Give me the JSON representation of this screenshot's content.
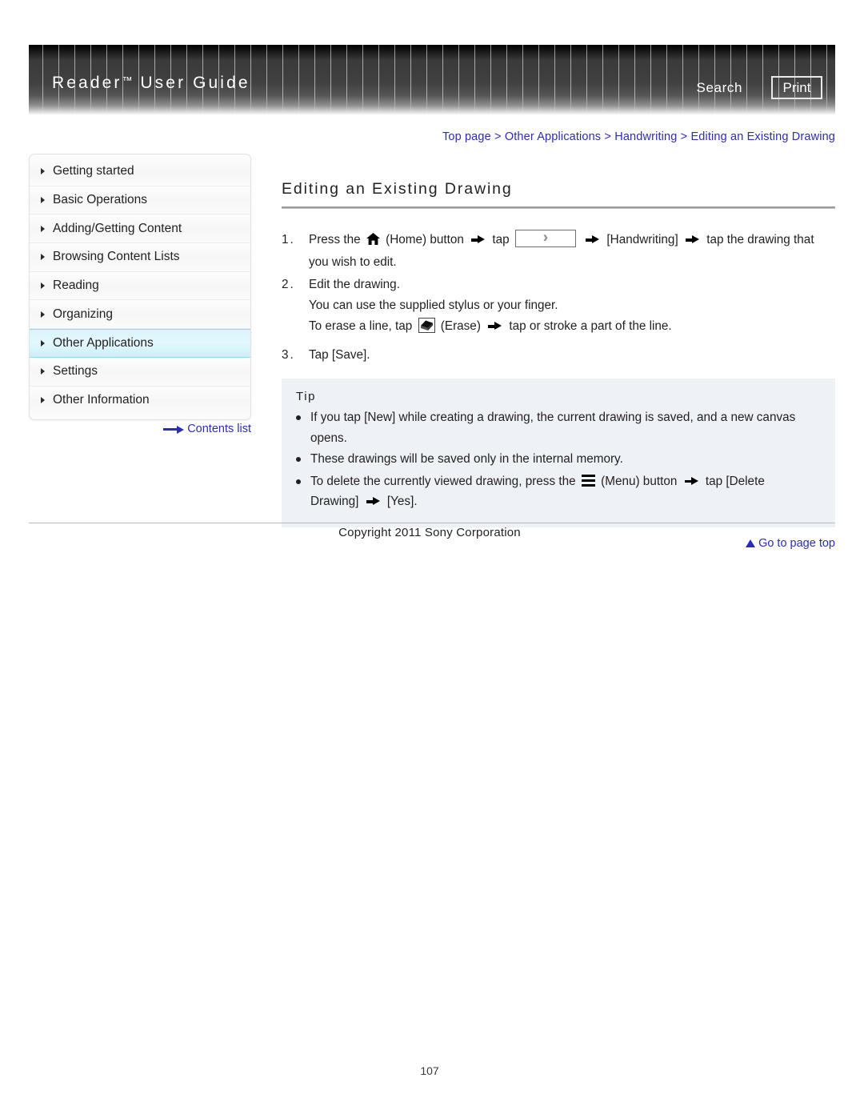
{
  "header": {
    "title": "Reader",
    "title_tm": "™",
    "title_rest": " User Guide",
    "search_label": "Search",
    "print_label": "Print"
  },
  "breadcrumb": {
    "items": [
      "Top page",
      "Other Applications",
      "Handwriting",
      "Editing an Existing Drawing"
    ],
    "separator": ">"
  },
  "sidebar": {
    "items": [
      {
        "label": "Getting started",
        "active": false
      },
      {
        "label": "Basic Operations",
        "active": false
      },
      {
        "label": "Adding/Getting Content",
        "active": false
      },
      {
        "label": "Browsing Content Lists",
        "active": false
      },
      {
        "label": "Reading",
        "active": false
      },
      {
        "label": "Organizing",
        "active": false
      },
      {
        "label": "Other Applications",
        "active": true
      },
      {
        "label": "Settings",
        "active": false
      },
      {
        "label": "Other Information",
        "active": false
      }
    ],
    "contents_list_label": "Contents list"
  },
  "main": {
    "page_title": "Editing an Existing Drawing",
    "steps": {
      "s1_num": "1.",
      "s1_a": "Press the",
      "s1_b": "(Home) button",
      "s1_c": "tap",
      "s1_d": "[Handwriting]",
      "s1_e": "tap the drawing that",
      "s1_f": "you wish to edit.",
      "s2_num": "2.",
      "s2_a": "Edit the drawing.",
      "s2_b": "You can use the supplied stylus or your finger.",
      "s2_c": "To erase a line, tap",
      "s2_d": "(Erase)",
      "s2_e": "tap or stroke a part of the line.",
      "s3_num": "3.",
      "s3_a": "Tap [Save]."
    },
    "tip": {
      "title": "Tip",
      "items": [
        "If you tap [New] while creating a drawing, the current drawing is saved, and a new canvas opens.",
        "These drawings will be saved only in the internal memory."
      ],
      "item3_a": "To delete the currently viewed drawing, press the",
      "item3_b": "(Menu) button",
      "item3_c": "tap [Delete",
      "item3_d": "Drawing]",
      "item3_e": "[Yes]."
    }
  },
  "footer": {
    "go_to_top": "Go to page top",
    "copyright": "Copyright 2011 Sony Corporation",
    "page_number": "107"
  },
  "colors": {
    "link": "#2b2bbf",
    "active_nav": "#d8f4fb",
    "tip_bg": "#eef1f5"
  }
}
